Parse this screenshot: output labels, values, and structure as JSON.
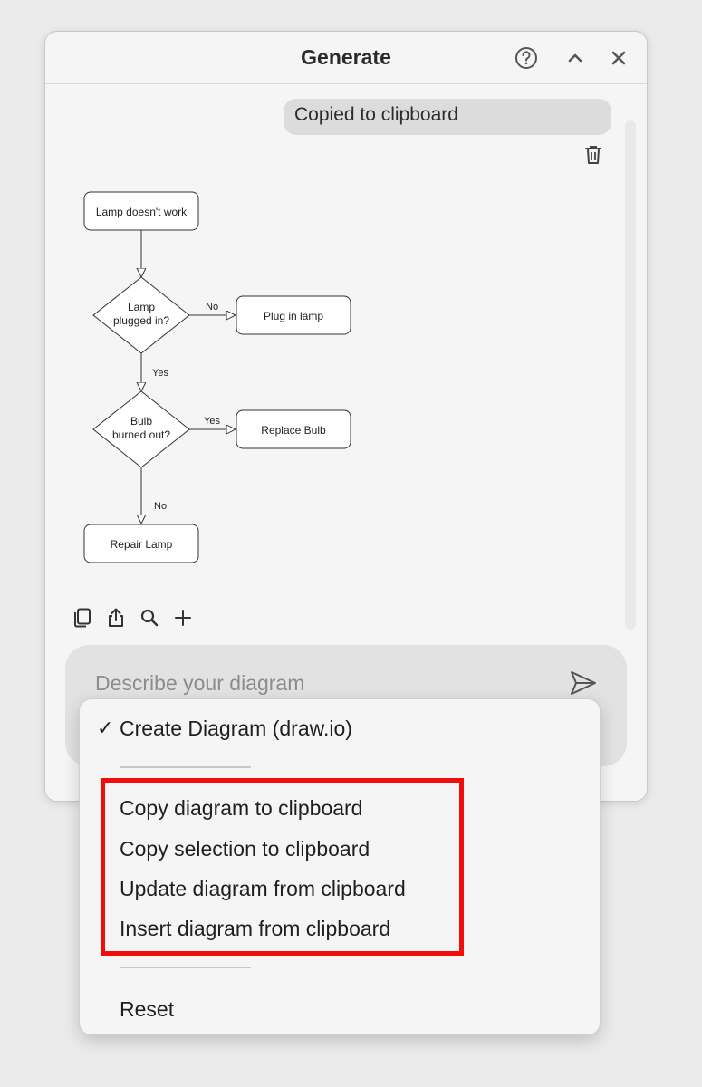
{
  "window": {
    "title": "Generate",
    "icons": {
      "help": "help-circle-icon",
      "collapse": "chevron-up-icon",
      "close": "close-icon"
    }
  },
  "chat": {
    "message": "Copied to clipboard",
    "delete_icon": "trash-icon"
  },
  "diagram": {
    "nodes": {
      "start": "Lamp doesn't work",
      "decision1": [
        "Lamp",
        "plugged in?"
      ],
      "action1": "Plug in lamp",
      "decision2": [
        "Bulb",
        "burned out?"
      ],
      "action2": "Replace Bulb",
      "end": "Repair Lamp"
    },
    "edges": {
      "d1_no": "No",
      "d1_yes": "Yes",
      "d2_yes": "Yes",
      "d2_no": "No"
    }
  },
  "actions": {
    "icons": [
      "copy-icon",
      "share-icon",
      "search-icon",
      "plus-icon"
    ]
  },
  "prompt": {
    "placeholder": "Describe your diagram",
    "send_icon": "send-icon"
  },
  "menu": {
    "checked_item": "Create Diagram (draw.io)",
    "clipboard_items": [
      "Copy diagram to clipboard",
      "Copy selection to clipboard",
      "Update diagram from clipboard",
      "Insert diagram from clipboard"
    ],
    "reset": "Reset"
  },
  "colors": {
    "highlight": "#f20d0d",
    "panel": "#f5f5f5",
    "input": "#e2e2e2"
  }
}
